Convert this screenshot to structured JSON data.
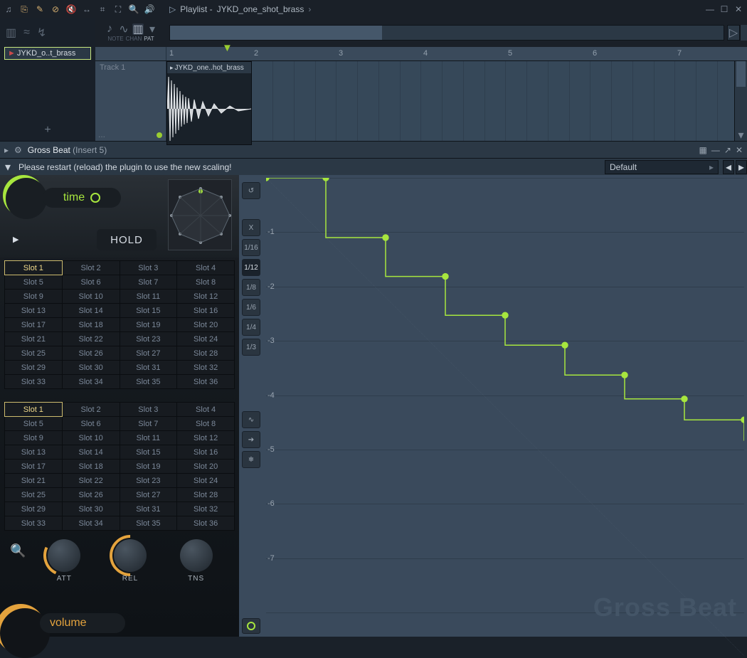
{
  "window": {
    "title_prefix": "Playlist -",
    "title_file": "JYKD_one_shot_brass",
    "minimize": "—",
    "maximize": "☐",
    "close": "✕"
  },
  "toolbar_mode": {
    "note": "NOTE",
    "chan": "CHAN",
    "pat": "PAT"
  },
  "track_panel": {
    "clip_short": "JYKD_o..t_brass",
    "add": "+"
  },
  "ruler": {
    "numbers": [
      "1",
      "2",
      "3",
      "4",
      "5",
      "6",
      "7"
    ]
  },
  "tracks": {
    "track1": "Track 1",
    "clip_label": "JYKD_one..hot_brass",
    "more": "..."
  },
  "plugin": {
    "name": "Gross Beat",
    "insert": "(Insert 5)",
    "message": "Please restart (reload) the plugin to use the new scaling!",
    "preset": "Default",
    "time_label": "time",
    "hold_label": "HOLD",
    "volume_label": "volume",
    "knobs": {
      "att": "ATT",
      "rel": "REL",
      "tns": "TNS"
    },
    "slots_a": [
      [
        "Slot 1",
        "Slot 2",
        "Slot 3",
        "Slot 4"
      ],
      [
        "Slot 5",
        "Slot 6",
        "Slot 7",
        "Slot 8"
      ],
      [
        "Slot 9",
        "Slot 10",
        "Slot 11",
        "Slot 12"
      ],
      [
        "Slot 13",
        "Slot 14",
        "Slot 15",
        "Slot 16"
      ],
      [
        "Slot 17",
        "Slot 18",
        "Slot 19",
        "Slot 20"
      ],
      [
        "Slot 21",
        "Slot 22",
        "Slot 23",
        "Slot 24"
      ],
      [
        "Slot 25",
        "Slot 26",
        "Slot 27",
        "Slot 28"
      ],
      [
        "Slot 29",
        "Slot 30",
        "Slot 31",
        "Slot 32"
      ],
      [
        "Slot 33",
        "Slot 34",
        "Slot 35",
        "Slot 36"
      ]
    ],
    "slots_b": [
      [
        "Slot 1",
        "Slot 2",
        "Slot 3",
        "Slot 4"
      ],
      [
        "Slot 5",
        "Slot 6",
        "Slot 7",
        "Slot 8"
      ],
      [
        "Slot 9",
        "Slot 10",
        "Slot 11",
        "Slot 12"
      ],
      [
        "Slot 13",
        "Slot 14",
        "Slot 15",
        "Slot 16"
      ],
      [
        "Slot 17",
        "Slot 18",
        "Slot 19",
        "Slot 20"
      ],
      [
        "Slot 21",
        "Slot 22",
        "Slot 23",
        "Slot 24"
      ],
      [
        "Slot 25",
        "Slot 26",
        "Slot 27",
        "Slot 28"
      ],
      [
        "Slot 29",
        "Slot 30",
        "Slot 31",
        "Slot 32"
      ],
      [
        "Slot 33",
        "Slot 34",
        "Slot 35",
        "Slot 36"
      ]
    ],
    "side_labels": [
      "↺",
      "X",
      "1/16",
      "1/12",
      "1/8",
      "1/6",
      "1/4",
      "1/3"
    ],
    "side_labels2": [
      "∿",
      "➔",
      "❄"
    ],
    "y_labels": [
      "-1",
      "-2",
      "-3",
      "-4",
      "-5",
      "-6",
      "-7"
    ],
    "brand": "Gross Beat"
  },
  "chart_data": {
    "type": "line",
    "description": "Time mapping envelope: 8 descending steps over one bar",
    "xlim": [
      0,
      1
    ],
    "ylim": [
      -8,
      0
    ],
    "points": [
      [
        0.0,
        0.0
      ],
      [
        0.125,
        0.0
      ],
      [
        0.125,
        -1.0
      ],
      [
        0.25,
        -1.0
      ],
      [
        0.25,
        -1.65
      ],
      [
        0.375,
        -1.65
      ],
      [
        0.375,
        -2.3
      ],
      [
        0.5,
        -2.3
      ],
      [
        0.5,
        -2.8
      ],
      [
        0.625,
        -2.8
      ],
      [
        0.625,
        -3.3
      ],
      [
        0.75,
        -3.3
      ],
      [
        0.75,
        -3.7
      ],
      [
        0.875,
        -3.7
      ],
      [
        0.875,
        -4.05
      ],
      [
        1.0,
        -4.05
      ],
      [
        1.0,
        -4.4
      ]
    ],
    "node_xy": [
      [
        0.0,
        0.0
      ],
      [
        0.125,
        0.0
      ],
      [
        0.25,
        -1.0
      ],
      [
        0.375,
        -1.65
      ],
      [
        0.5,
        -2.3
      ],
      [
        0.625,
        -2.8
      ],
      [
        0.75,
        -3.3
      ],
      [
        0.875,
        -3.7
      ],
      [
        1.0,
        -4.05
      ]
    ]
  }
}
